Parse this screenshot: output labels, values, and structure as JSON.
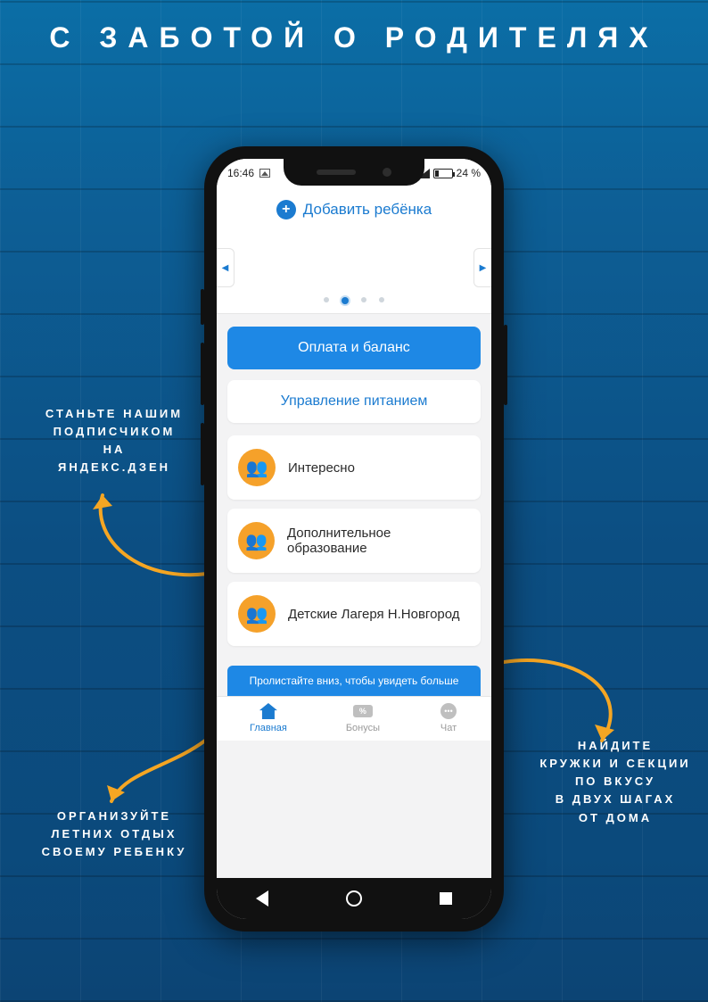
{
  "page_title": "С ЗАБОТОЙ О РОДИТЕЛЯХ",
  "callouts": {
    "subscribe": "СТАНЬТЕ НАШИМ\nПОДПИСЧИКОМ\nНА\nЯНДЕКС.ДЗЕН",
    "vacation": "ОРГАНИЗУЙТЕ\nЛЕТНИХ ОТДЫХ\nСВОЕМУ РЕБЕНКУ",
    "clubs": "НАЙДИТЕ\nКРУЖКИ И СЕКЦИИ\nПО ВКУСУ\nВ ДВУХ ШАГАХ\nОТ ДОМА"
  },
  "statusbar": {
    "time": "16:46",
    "battery": "24 %"
  },
  "app": {
    "add_child": "Добавить ребёнка",
    "buttons": {
      "balance": "Оплата и баланс",
      "meals": "Управление питанием"
    },
    "rows": {
      "interesting": "Интересно",
      "education": "Дополнительное образование",
      "camps": "Детские Лагеря Н.Новгород"
    },
    "scroll_hint": "Пролистайте вниз, чтобы увидеть больше",
    "tabs": {
      "home": "Главная",
      "bonuses": "Бонусы",
      "chat": "Чат"
    }
  }
}
